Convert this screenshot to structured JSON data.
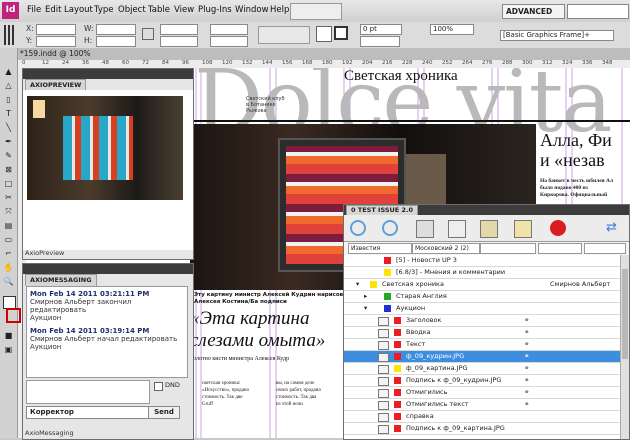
{
  "menubar": {
    "logo": "Id",
    "items": [
      "File",
      "Edit",
      "Layout",
      "Type",
      "Object",
      "Table",
      "View",
      "Plug-Ins",
      "Window",
      "Help"
    ],
    "workspace": "ADVANCED"
  },
  "control_bar": {
    "x_label": "X:",
    "y_label": "Y:",
    "w_label": "W:",
    "h_label": "H:",
    "stroke_value": "0 pt",
    "zoom": "100%",
    "frame_style": "[Basic Graphics Frame]+"
  },
  "document": {
    "tab": "*159.indd @ 100%"
  },
  "ruler_ticks": [
    "0",
    "12",
    "24",
    "36",
    "48",
    "60",
    "72",
    "84",
    "96",
    "108",
    "120",
    "132",
    "144",
    "156",
    "168",
    "180",
    "192",
    "204",
    "216",
    "228",
    "240",
    "252",
    "264",
    "276",
    "288",
    "300",
    "312",
    "324",
    "336",
    "348",
    "360"
  ],
  "page": {
    "masthead": "Dolce vita",
    "section": "Светская хроника",
    "small_caption": "Светский клуб\nв Ботанике\nРыжова",
    "headline_right_1": "Алла, Фи",
    "headline_right_2": "и «незав",
    "body_right": "На банкет в честь юбилея Ал\nбыло подано 400 из\nКиркорова. Официальный",
    "photo_caption": "Эту картину министр Алексей Кудрин нарисовал за три\nАлексея Костина/Ба подписи",
    "quote_1": "«Эта картина",
    "quote_2": "слезами омыта»",
    "quote_sub": "полотно кисти министра Алексея Кудр",
    "col_1": "…представили бизнесмены\nсветские хроники вечера\nдома Бондарчук и Эрве\nи т. д.",
    "col_2": "светская хроника:\n«Искусство», продано\nстоимость. Так две\nGruff",
    "col_3": "вы, на самом деле\nсвоих работ, продано\nстоимость. Так два\nиз этой ночи"
  },
  "axiopreview": {
    "header": "AXIOPREVIEW",
    "footer": "AxioPreview"
  },
  "axiomessaging": {
    "header": "AXIOMESSAGING",
    "messages": [
      {
        "head": "Mon Feb 14 2011 03:21:11 PM",
        "line1": "Смирнов Альберт закончил редактировать",
        "line2": "Аукцион"
      },
      {
        "head": "Mon Feb 14 2011 03:19:14 PM",
        "line1": "Смирнов Альберт начал редактировать",
        "line2": "Аукцион"
      }
    ],
    "dnd_label": "DND",
    "recipient": "Корректор",
    "send_label": "Send",
    "footer": "AxioMessaging"
  },
  "test_issue": {
    "header": "0 TEST ISSUE 2.0",
    "filter_1": "Известия",
    "filter_2": "Московский 2 (2)",
    "rows": [
      {
        "label": "[5] - Новости UP 3",
        "color": "#ee1c24"
      },
      {
        "label": "[6.8/3] - Мнения и комментарии",
        "color": "#ffe600"
      },
      {
        "label": "Светская хроника",
        "color": "#ffe600",
        "assignee": "Смирнов Альберт"
      },
      {
        "label": "Старая Англия",
        "color": "#22aa22"
      },
      {
        "label": "Аукцион",
        "color": "#1f2fd0"
      },
      {
        "label": "Заголовок",
        "color": "#ee1c24"
      },
      {
        "label": "Вводка",
        "color": "#ee1c24"
      },
      {
        "label": "Текст",
        "color": "#ee1c24"
      },
      {
        "label": "ф_09_кудрин.JPG",
        "color": "#ee1c24",
        "selected": true
      },
      {
        "label": "ф_09_картина.JPG",
        "color": "#ffe600"
      },
      {
        "label": "Подпись к ф_09_кудрин.JPG",
        "color": "#ee1c24"
      },
      {
        "label": "Отмигились",
        "color": "#ee1c24"
      },
      {
        "label": "Отмигились текст",
        "color": "#ee1c24"
      },
      {
        "label": "справка",
        "color": "#ee1c24"
      },
      {
        "label": "Подпись к ф_09_картина.JPG",
        "color": "#ee1c24"
      }
    ]
  }
}
